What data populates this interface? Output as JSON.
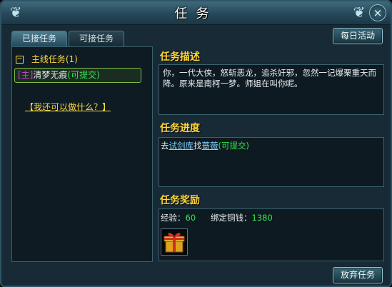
{
  "window": {
    "title": "任务"
  },
  "tabs": [
    {
      "label": "已接任务"
    },
    {
      "label": "可接任务"
    }
  ],
  "daily_button": "每日活动",
  "quest_list": {
    "category": {
      "toggle": "−",
      "label": "主线任务(1)"
    },
    "selected_quest": {
      "tag": "[主]",
      "name": "清梦无痕",
      "status": "(可提交)"
    },
    "help_link": "【我还可以做什么？】"
  },
  "description": {
    "heading": "任务描述",
    "text": "你，一代大侠，怒斩恶龙，追杀奸邪，忽然一记爆栗重天而降。原来是南柯一梦。师姐在叫你呢。"
  },
  "progress": {
    "heading": "任务进度",
    "prefix": "去",
    "place_link": "试剑库",
    "middle": "找",
    "npc_link": "蔷薇",
    "status": "(可提交)"
  },
  "reward": {
    "heading": "任务奖励",
    "exp_label": "经验：",
    "exp_value": "60",
    "bound_money_label": "绑定铜钱：",
    "bound_money_value": "1380",
    "item_icon": "gift-box-icon"
  },
  "abandon_button": "放弃任务",
  "colors": {
    "gold": "#ffd83c",
    "green": "#33e64a",
    "magenta": "#d83cdc",
    "link": "#7fd2ff"
  }
}
